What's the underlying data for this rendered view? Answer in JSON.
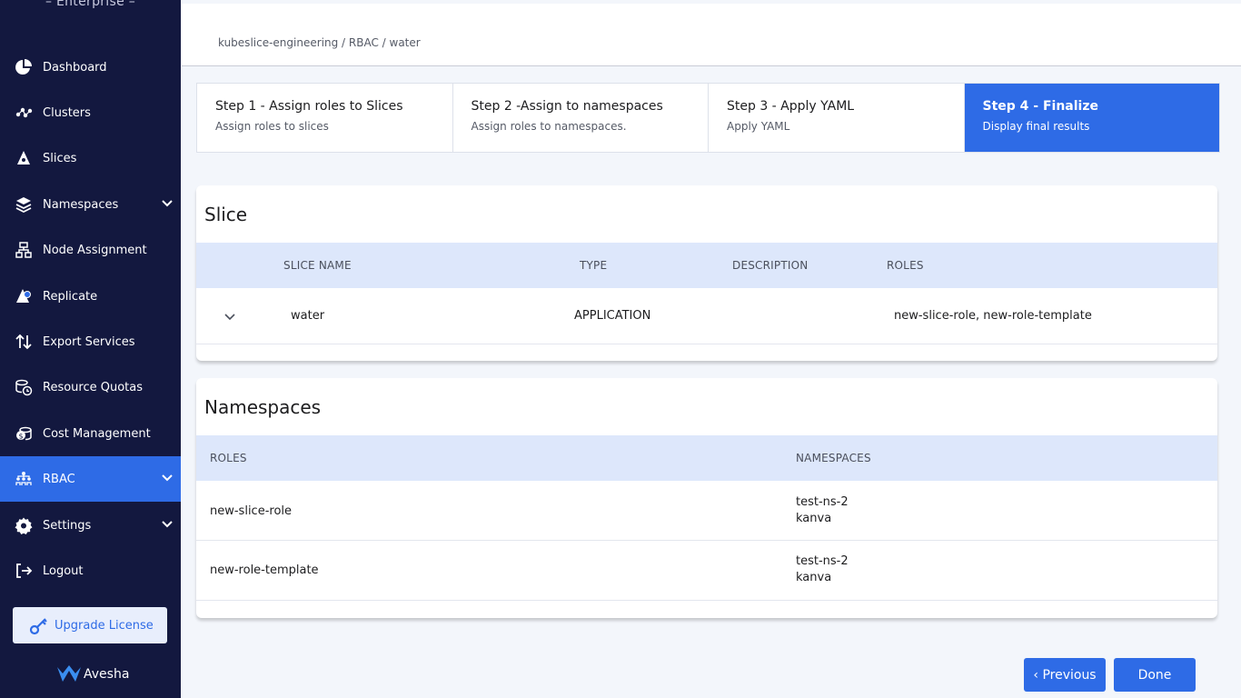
{
  "sidebar": {
    "brand_sub": "– Enterprise –",
    "items": [
      {
        "label": "Dashboard",
        "icon": "pie-chart-icon"
      },
      {
        "label": "Clusters",
        "icon": "cluster-nodes-icon"
      },
      {
        "label": "Slices",
        "icon": "slice-icon"
      },
      {
        "label": "Namespaces",
        "icon": "layers-icon"
      },
      {
        "label": "Node Assignment",
        "icon": "sitemap-icon"
      },
      {
        "label": "Replicate",
        "icon": "replicate-icon"
      },
      {
        "label": "Export Services",
        "icon": "arrows-updown-icon"
      },
      {
        "label": "Resource Quotas",
        "icon": "coins-clock-icon"
      },
      {
        "label": "Cost Management",
        "icon": "cost-coins-icon"
      },
      {
        "label": "RBAC",
        "icon": "rbac-people-icon"
      },
      {
        "label": "Settings",
        "icon": "gear-icon"
      },
      {
        "label": "Logout",
        "icon": "logout-icon"
      }
    ],
    "active": "RBAC",
    "upgrade_label": "Upgrade License",
    "logo_text": "Avesha"
  },
  "header": {
    "breadcrumb": "kubeslice-engineering / RBAC / water"
  },
  "steps": [
    {
      "title": "Step 1 - Assign roles to Slices",
      "desc": "Assign roles to slices"
    },
    {
      "title": "Step 2 -Assign to namespaces",
      "desc": "Assign roles to namespaces."
    },
    {
      "title": "Step 3 - Apply YAML",
      "desc": "Apply YAML"
    },
    {
      "title": "Step 4 - Finalize",
      "desc": "Display final results"
    }
  ],
  "slice_section": {
    "title": "Slice",
    "columns": [
      "SLICE NAME",
      "TYPE",
      "DESCRIPTION",
      "ROLES"
    ],
    "rows": [
      {
        "name": "water",
        "type": "APPLICATION",
        "description": "",
        "roles": "new-slice-role, new-role-template"
      }
    ]
  },
  "namespaces_section": {
    "title": "Namespaces",
    "columns": [
      "ROLES",
      "NAMESPACES"
    ],
    "rows": [
      {
        "role": "new-slice-role",
        "ns1": "test-ns-2",
        "ns2": "kanva"
      },
      {
        "role": "new-role-template",
        "ns1": "test-ns-2",
        "ns2": "kanva"
      }
    ]
  },
  "footer": {
    "previous_label": "‹ Previous",
    "done_label": "Done"
  },
  "colors": {
    "sidebar_bg": "#13183f",
    "accent": "#2e6be6",
    "table_header_bg": "#dde7fb"
  }
}
